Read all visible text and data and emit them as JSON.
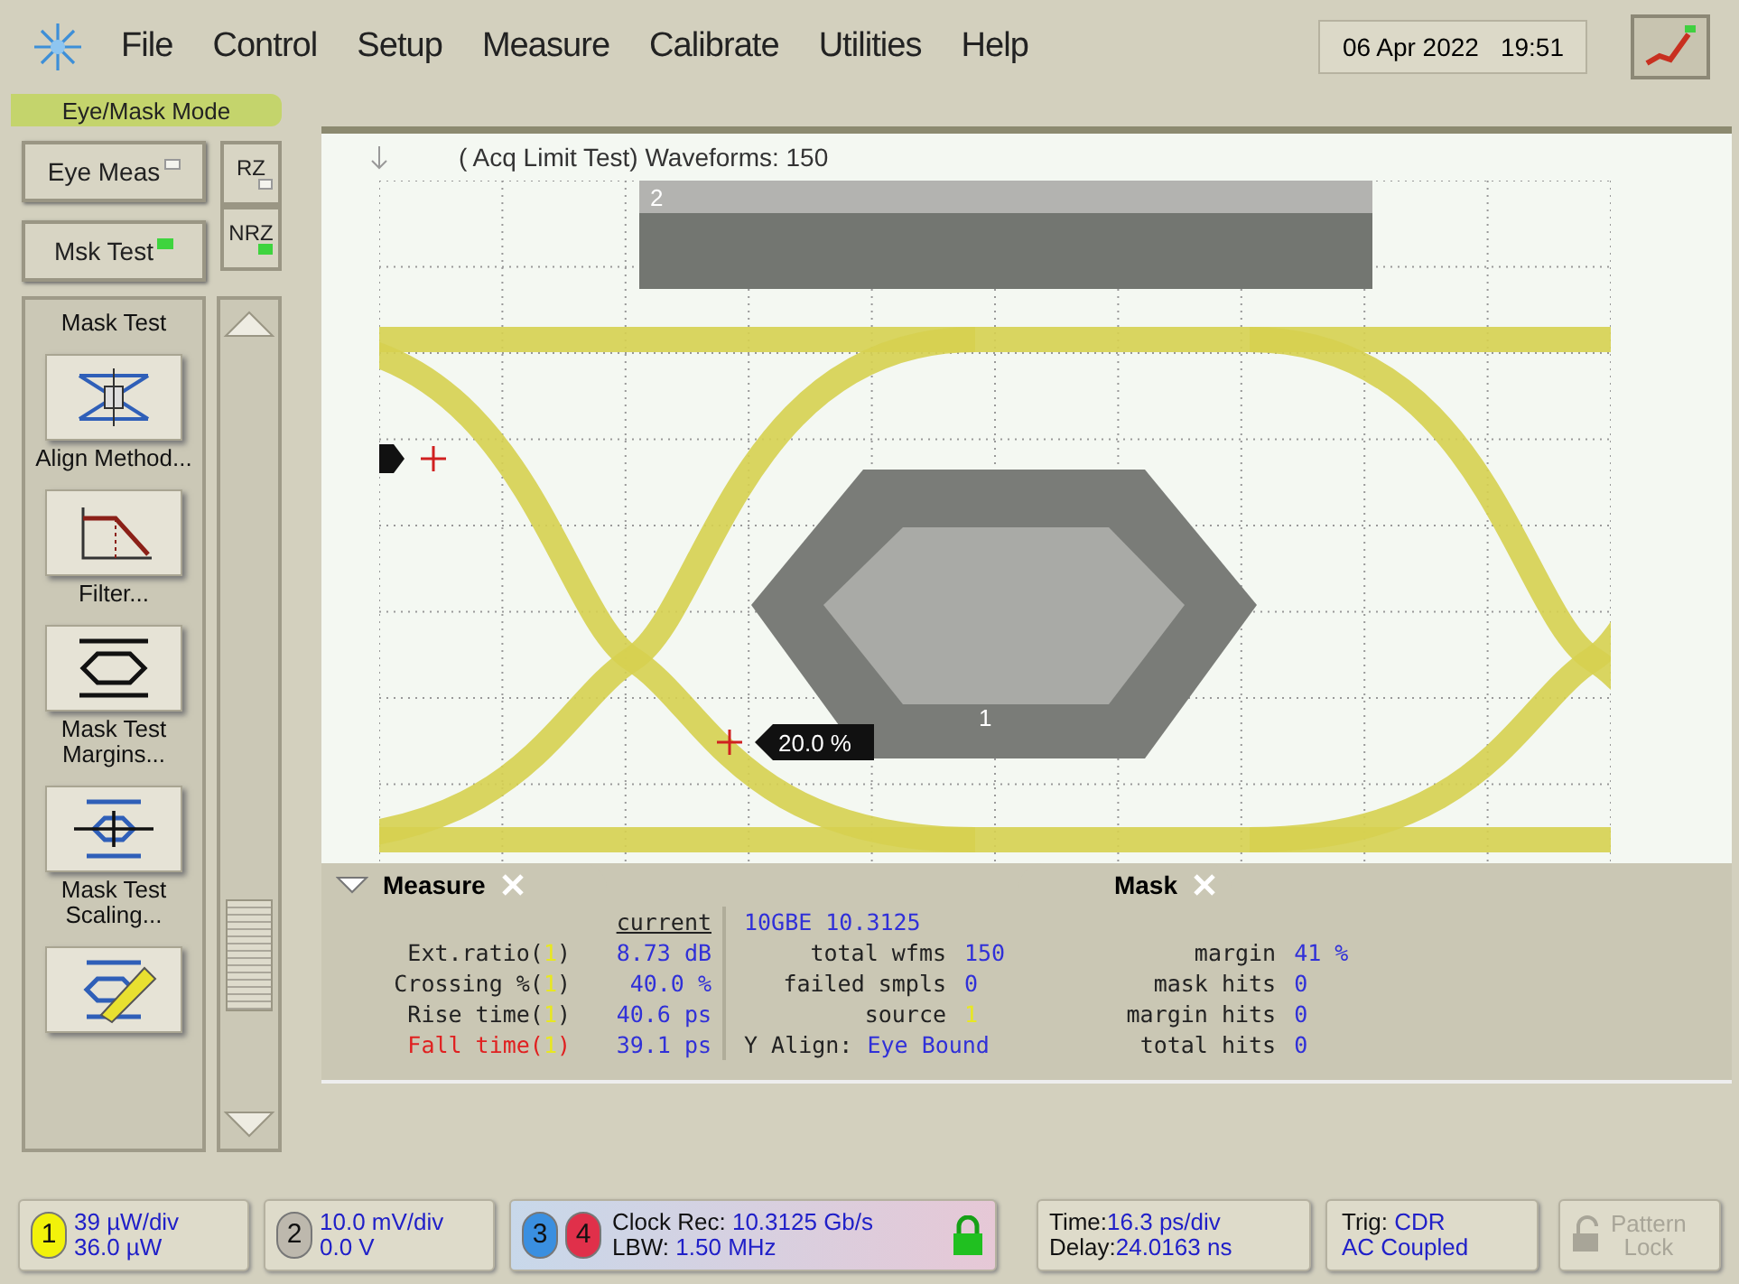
{
  "menu": {
    "items": [
      "File",
      "Control",
      "Setup",
      "Measure",
      "Calibrate",
      "Utilities",
      "Help"
    ],
    "date": "06 Apr 2022",
    "time": "19:51"
  },
  "mode_label": "Eye/Mask Mode",
  "mode_buttons": [
    {
      "label": "Eye Meas",
      "on": false
    },
    {
      "label": "Msk Test",
      "on": true
    }
  ],
  "format_buttons": [
    {
      "label": "RZ",
      "on": false
    },
    {
      "label": "NRZ",
      "on": true
    }
  ],
  "sidebar": {
    "heading": "Mask Test",
    "items": [
      {
        "kind": "align",
        "label": "Align Method..."
      },
      {
        "kind": "filter",
        "label": "Filter..."
      },
      {
        "kind": "margins",
        "label": "Mask Test Margins..."
      },
      {
        "kind": "scaling",
        "label": "Mask Test Scaling..."
      },
      {
        "kind": "edit"
      }
    ]
  },
  "graph": {
    "title": "( Acq Limit Test)  Waveforms: 150",
    "mask_labels": [
      "2",
      "1"
    ],
    "marker_reading": "20.0 %"
  },
  "measure": {
    "tab": "Measure",
    "column": "current",
    "rows": [
      {
        "label": "Ext.ratio(",
        "source": "1",
        "suffix": ")",
        "value": "8.73 dB",
        "selected": false
      },
      {
        "label": "Crossing %(",
        "source": "1",
        "suffix": ")",
        "value": "40.0 %",
        "selected": false
      },
      {
        "label": "Rise time(",
        "source": "1",
        "suffix": ")",
        "value": "40.6 ps",
        "selected": false
      },
      {
        "label": "Fall time(",
        "source": "1",
        "suffix": ")",
        "value": "39.1 ps",
        "selected": true
      }
    ]
  },
  "mask": {
    "tab": "Mask",
    "standard": "10GBE 10.3125",
    "left": [
      {
        "label": "total wfms",
        "value": "150",
        "kind": "count"
      },
      {
        "label": "failed smpls",
        "value": "0",
        "kind": "count"
      },
      {
        "label": "source",
        "value": "1",
        "kind": "source"
      },
      {
        "label": "Y Align:",
        "value": "Eye Bound",
        "kind": "inline"
      }
    ],
    "right": [
      {
        "label": "margin",
        "value": "41 %"
      },
      {
        "label": "mask hits",
        "value": "0"
      },
      {
        "label": "margin hits",
        "value": "0"
      },
      {
        "label": "total hits",
        "value": "0"
      }
    ]
  },
  "status_bar": {
    "channels": [
      {
        "number": "1",
        "color": "#f2f20a",
        "lines": [
          "39 µW/div",
          "36.0 µW"
        ]
      },
      {
        "number": "2",
        "color": "#bdb8ad",
        "lines": [
          "10.0 mV/div",
          "0.0 V"
        ]
      }
    ],
    "clock": {
      "badges": [
        {
          "number": "3",
          "color": "#3a8fe0"
        },
        {
          "number": "4",
          "color": "#e0304a"
        }
      ],
      "rate_label": "Clock Rec:",
      "rate": "10.3125 Gb/s",
      "bw_label": "LBW:",
      "bw": "1.50 MHz",
      "locked": true
    },
    "timebase": [
      {
        "label": "Time:",
        "value": "16.3 ps/div"
      },
      {
        "label": "Delay:",
        "value": "24.0163 ns"
      }
    ],
    "trigger": {
      "label": "Trig:",
      "value": "CDR",
      "coupling": "AC Coupled"
    },
    "pattern_lock": {
      "label": [
        "Pattern",
        "Lock"
      ],
      "disabled": true
    }
  }
}
